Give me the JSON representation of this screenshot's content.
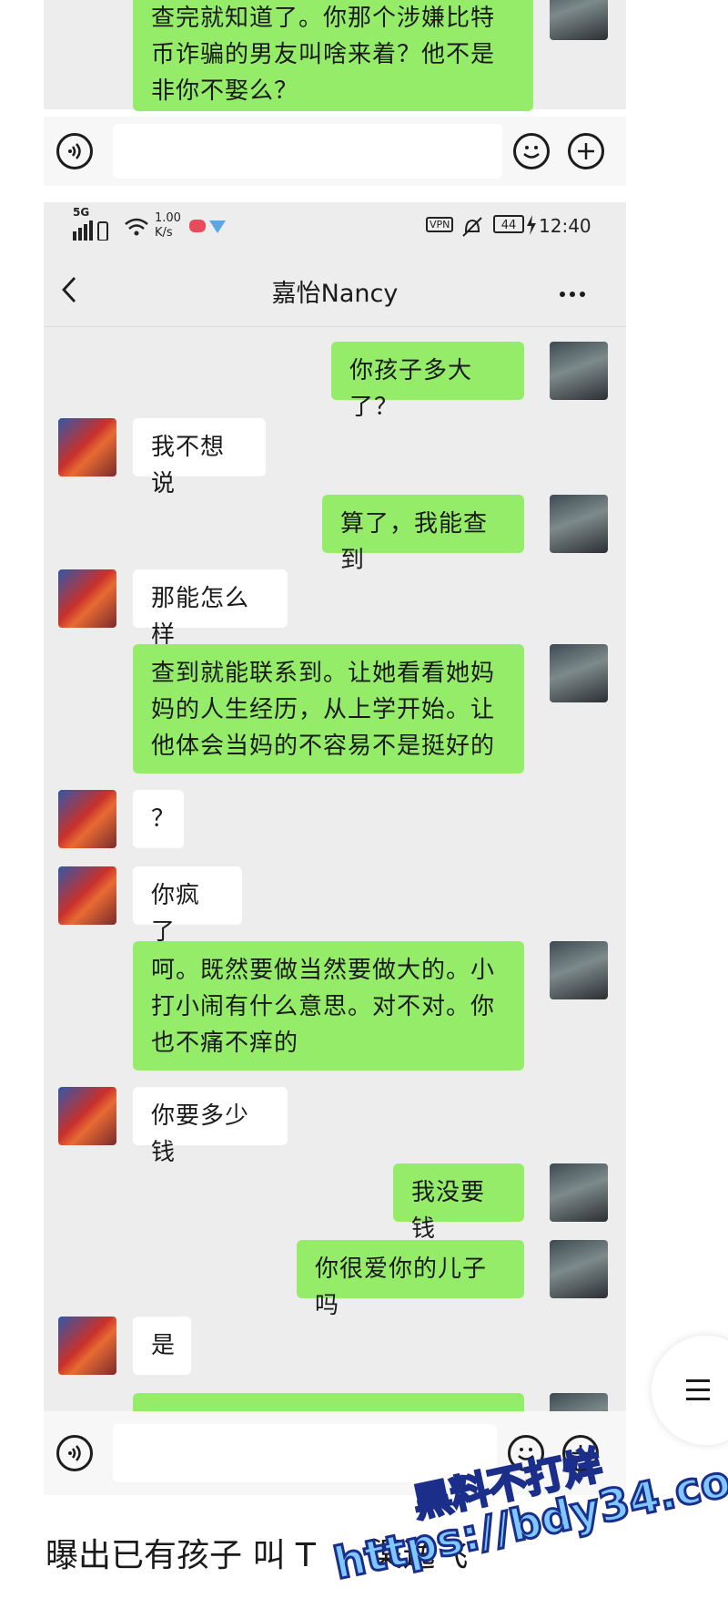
{
  "top_fragment": {
    "message": "查完就知道了。你那个涉嫌比特币诈骗的男友叫啥来着？他不是非你不娶么？"
  },
  "status_bar": {
    "signal": "5G",
    "speed_value": "1.00",
    "speed_unit": "K/s",
    "vpn": "VPN",
    "battery": "44",
    "time": "12:40"
  },
  "chat": {
    "title": "嘉怡Nancy",
    "messages": [
      {
        "from": "me",
        "text": "你孩子多大了？"
      },
      {
        "from": "them",
        "text": "我不想说"
      },
      {
        "from": "me",
        "text": "算了，我能查到"
      },
      {
        "from": "them",
        "text": "那能怎么样"
      },
      {
        "from": "me",
        "text": "查到就能联系到。让她看看她妈妈的人生经历，从上学开始。让他体会当妈的不容易不是挺好的"
      },
      {
        "from": "them",
        "text": "？"
      },
      {
        "from": "them",
        "text": "你疯了"
      },
      {
        "from": "me",
        "text": "呵。既然要做当然要做大的。小打小闹有什么意思。对不对。你也不痛不痒的"
      },
      {
        "from": "them",
        "text": "你要多少钱"
      },
      {
        "from": "me",
        "text": "我没要钱"
      },
      {
        "from": "me",
        "text": "你很爱你的儿子吗"
      },
      {
        "from": "them",
        "text": "是"
      }
    ]
  },
  "caption": "曝出已有孩子 叫 T",
  "caption_tail": "渠逸飞",
  "watermark": {
    "line1": "黑料不打烊",
    "line2": "https://bdy34.co"
  },
  "floating_menu_icon": "hamburger-icon",
  "colors": {
    "my_bubble": "#95ec69",
    "their_bubble": "#ffffff",
    "chat_background": "#ededed"
  }
}
